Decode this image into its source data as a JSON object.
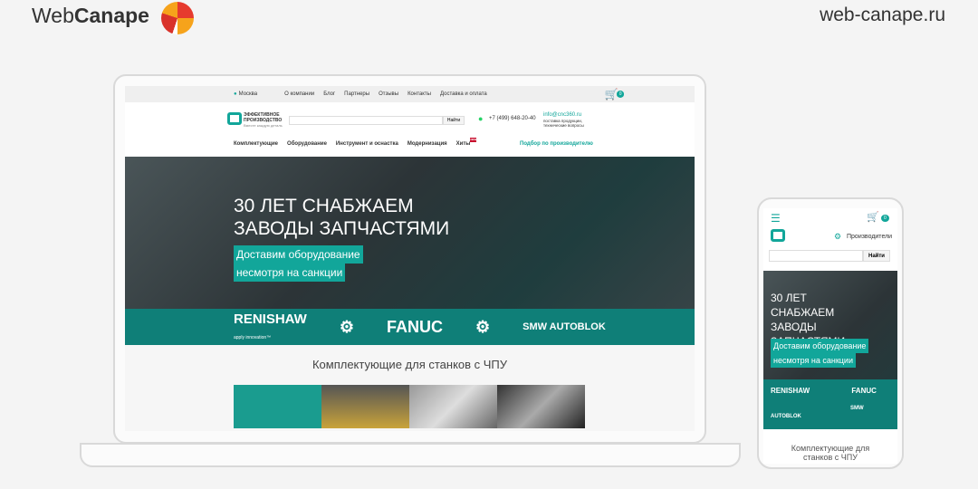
{
  "brand": {
    "name_light": "Web",
    "name_bold": "Canape",
    "site": "web-canape.ru"
  },
  "desktop": {
    "topbar": {
      "city": "Москва",
      "links": [
        "О компании",
        "Блог",
        "Партнеры",
        "Отзывы",
        "Контакты",
        "Доставка и оплата"
      ],
      "cart_count": "0"
    },
    "header": {
      "logo_line1": "ЭФФЕКТИВНОЕ",
      "logo_line2": "ПРОИЗВОДСТВО",
      "logo_tag": "Вместе каждую деталь",
      "search_placeholder": "",
      "search_button": "Найти",
      "phone": "+7 (499) 648-20-40",
      "email": "info@cnc360.ru",
      "email_note": "поставка продукции, технические вопросы"
    },
    "nav": {
      "items": [
        "Комплектующие",
        "Оборудование",
        "Инструмент и оснастка",
        "Модернизация",
        "Хиты"
      ],
      "badge": "NEW",
      "right_link": "Подбор по производителю"
    },
    "hero": {
      "title": "30 ЛЕТ СНАБЖАЕМ ЗАВОДЫ ЗАПЧАСТЯМИ",
      "sub1": "Доставим оборудование",
      "sub2": "несмотря на санкции",
      "brands": [
        "RENISHAW",
        "FANUC",
        "SMW AUTOBLOK"
      ],
      "renishaw_tag": "apply innovation™"
    },
    "section_title": "Комплектующие для станков с ЧПУ"
  },
  "mobile": {
    "cart_count": "0",
    "manufacturers": "Производители",
    "search_button": "Найти",
    "hero_title": "30 ЛЕТ СНАБЖАЕМ ЗАВОДЫ ЗАПЧАСТЯМИ",
    "sub1": "Доставим оборудование",
    "sub2": "несмотря на санкции",
    "brands": [
      "RENISHAW",
      "FANUC",
      "SMW AUTOBLOK"
    ],
    "section_title": "Комплектующие для станков с ЧПУ"
  },
  "colors": {
    "accent": "#12a69a",
    "dark_teal": "#0f7f78"
  }
}
